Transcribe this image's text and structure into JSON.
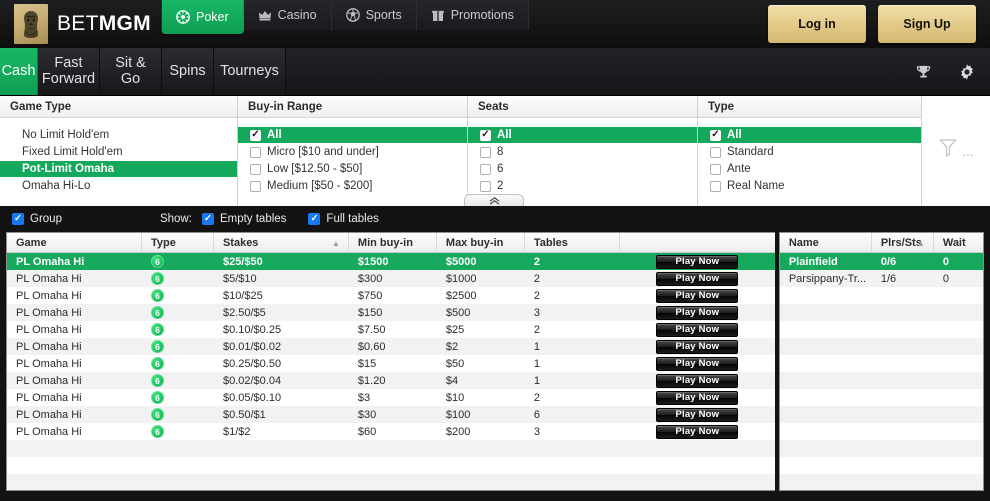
{
  "brand": {
    "name_light": "BET",
    "name_bold": "MGM",
    "logo_icon": "lion-head-icon"
  },
  "topnav": {
    "tabs": [
      {
        "label": "Poker",
        "icon": "poker-chip-icon",
        "active": true
      },
      {
        "label": "Casino",
        "icon": "crown-icon",
        "active": false
      },
      {
        "label": "Sports",
        "icon": "sports-ball-icon",
        "active": false
      },
      {
        "label": "Promotions",
        "icon": "gift-icon",
        "active": false
      }
    ],
    "login_label": "Log in",
    "signup_label": "Sign Up"
  },
  "subnav": {
    "tabs": [
      {
        "label": "Cash",
        "active": true
      },
      {
        "label": "Fast Forward",
        "active": false
      },
      {
        "label": "Sit & Go",
        "active": false
      },
      {
        "label": "Spins",
        "active": false
      },
      {
        "label": "Tourneys",
        "active": false
      }
    ],
    "trophy_icon": "trophy-icon",
    "settings_icon": "gear-icon"
  },
  "filters": {
    "game_type": {
      "header": "Game Type",
      "options": [
        {
          "label": "No Limit Hold'em",
          "selected": false
        },
        {
          "label": "Fixed Limit Hold'em",
          "selected": false
        },
        {
          "label": "Pot-Limit Omaha",
          "selected": true
        },
        {
          "label": "Omaha Hi-Lo",
          "selected": false
        }
      ]
    },
    "buyin_range": {
      "header": "Buy-in Range",
      "options": [
        {
          "label": "All",
          "checked": true,
          "selected": true
        },
        {
          "label": "Micro [$10 and under]",
          "checked": false,
          "selected": false
        },
        {
          "label": "Low [$12.50 - $50]",
          "checked": false,
          "selected": false
        },
        {
          "label": "Medium [$50 - $200]",
          "checked": false,
          "selected": false
        }
      ]
    },
    "seats": {
      "header": "Seats",
      "options": [
        {
          "label": "All",
          "checked": true,
          "selected": true
        },
        {
          "label": "8",
          "checked": false,
          "selected": false
        },
        {
          "label": "6",
          "checked": false,
          "selected": false
        },
        {
          "label": "2",
          "checked": false,
          "selected": false
        }
      ]
    },
    "type": {
      "header": "Type",
      "options": [
        {
          "label": "All",
          "checked": true,
          "selected": true
        },
        {
          "label": "Standard",
          "checked": false,
          "selected": false
        },
        {
          "label": "Ante",
          "checked": false,
          "selected": false
        },
        {
          "label": "Real Name",
          "checked": false,
          "selected": false
        }
      ]
    },
    "more_filters_icon": "filter-funnel-icon",
    "collapse_icon": "double-chevron-up-icon"
  },
  "showbar": {
    "group_label": "Group",
    "group_checked": true,
    "show_label": "Show:",
    "empty_tables_label": "Empty tables",
    "empty_tables_checked": true,
    "full_tables_label": "Full tables",
    "full_tables_checked": true
  },
  "lobby_table": {
    "columns": [
      "Game",
      "Type",
      "Stakes",
      "Min buy-in",
      "Max buy-in",
      "Tables",
      ""
    ],
    "sorted_column": "Stakes",
    "sort_direction": "asc",
    "action_label": "Play Now",
    "rows": [
      {
        "game": "PL Omaha Hi",
        "type": "6",
        "stakes": "$25/$50",
        "min": "$1500",
        "max": "$5000",
        "tables": "2",
        "selected": true
      },
      {
        "game": "PL Omaha Hi",
        "type": "6",
        "stakes": "$5/$10",
        "min": "$300",
        "max": "$1000",
        "tables": "2",
        "selected": false
      },
      {
        "game": "PL Omaha Hi",
        "type": "6",
        "stakes": "$10/$25",
        "min": "$750",
        "max": "$2500",
        "tables": "2",
        "selected": false
      },
      {
        "game": "PL Omaha Hi",
        "type": "6",
        "stakes": "$2.50/$5",
        "min": "$150",
        "max": "$500",
        "tables": "3",
        "selected": false
      },
      {
        "game": "PL Omaha Hi",
        "type": "6",
        "stakes": "$0.10/$0.25",
        "min": "$7.50",
        "max": "$25",
        "tables": "2",
        "selected": false
      },
      {
        "game": "PL Omaha Hi",
        "type": "6",
        "stakes": "$0.01/$0.02",
        "min": "$0.60",
        "max": "$2",
        "tables": "1",
        "selected": false
      },
      {
        "game": "PL Omaha Hi",
        "type": "6",
        "stakes": "$0.25/$0.50",
        "min": "$15",
        "max": "$50",
        "tables": "1",
        "selected": false
      },
      {
        "game": "PL Omaha Hi",
        "type": "6",
        "stakes": "$0.02/$0.04",
        "min": "$1.20",
        "max": "$4",
        "tables": "1",
        "selected": false
      },
      {
        "game": "PL Omaha Hi",
        "type": "6",
        "stakes": "$0.05/$0.10",
        "min": "$3",
        "max": "$10",
        "tables": "2",
        "selected": false
      },
      {
        "game": "PL Omaha Hi",
        "type": "6",
        "stakes": "$0.50/$1",
        "min": "$30",
        "max": "$100",
        "tables": "6",
        "selected": false
      },
      {
        "game": "PL Omaha Hi",
        "type": "6",
        "stakes": "$1/$2",
        "min": "$60",
        "max": "$200",
        "tables": "3",
        "selected": false
      }
    ]
  },
  "tables_panel": {
    "columns": [
      "Name",
      "Plrs/Sts",
      "Wait"
    ],
    "sorted_column": "Plrs/Sts",
    "sort_direction": "asc",
    "rows": [
      {
        "name": "Plainfield",
        "plrs": "0/6",
        "wait": "0",
        "selected": true
      },
      {
        "name": "Parsippany-Tr...",
        "plrs": "1/6",
        "wait": "0",
        "selected": false
      }
    ]
  },
  "colors": {
    "brand_green": "#16a85c",
    "brand_gold": "#e5cd8e",
    "dark_chrome": "#131314",
    "checkbox_blue": "#1778f2"
  }
}
